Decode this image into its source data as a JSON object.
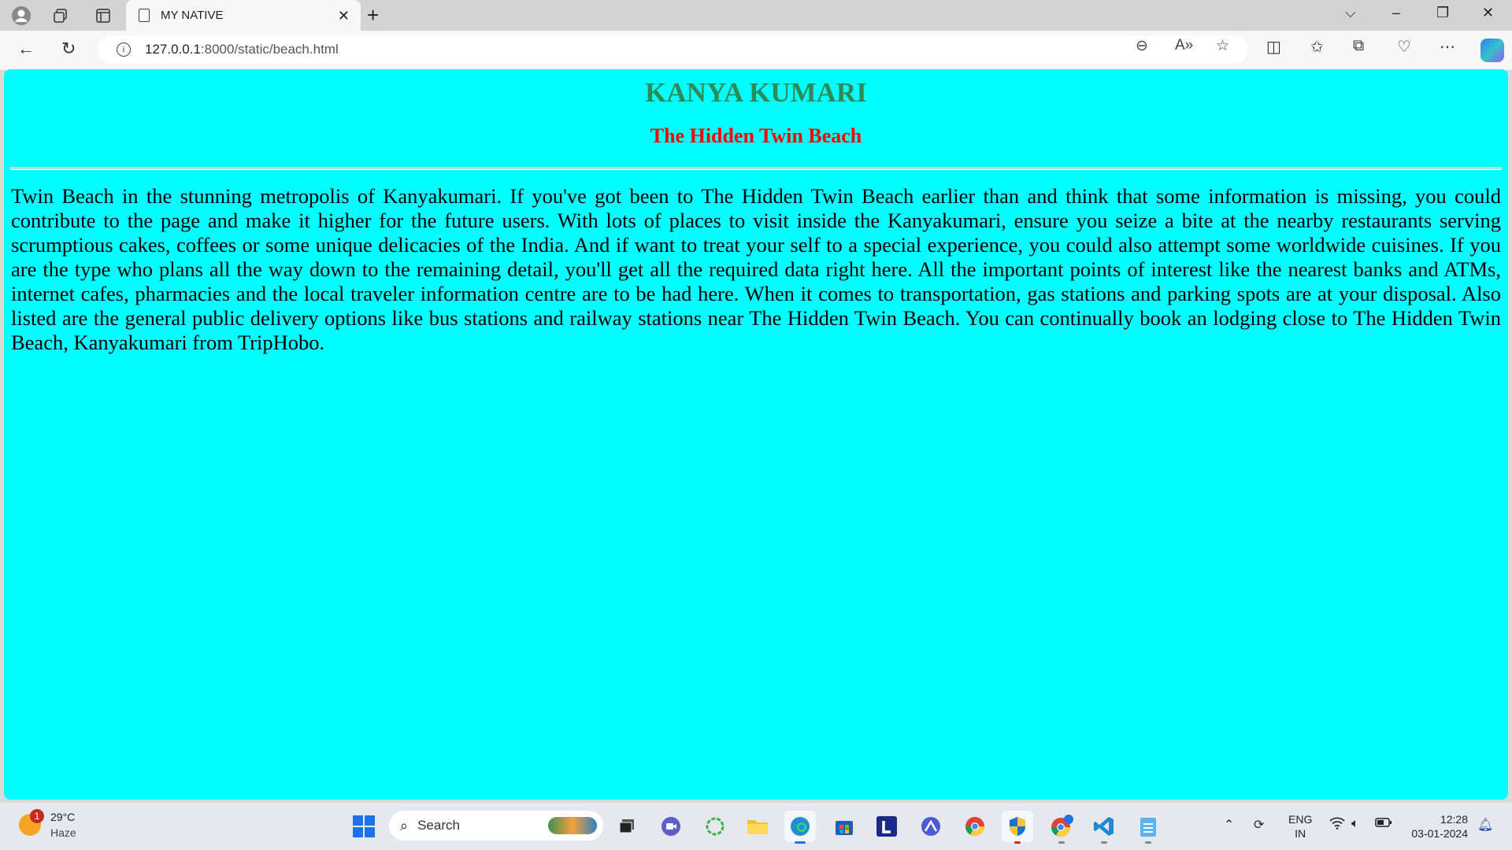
{
  "browser": {
    "tab_title": "MY NATIVE",
    "url_host": "127.0.0.1",
    "url_path": ":8000/static/beach.html"
  },
  "page": {
    "heading": "KANYA KUMARI",
    "subheading": "The Hidden Twin Beach",
    "paragraph": "Twin Beach in the stunning metropolis of Kanyakumari. If you've got been to The Hidden Twin Beach earlier than and think that some information is missing, you could contribute to the page and make it higher for the future users. With lots of places to visit inside the Kanyakumari, ensure you seize a bite at the nearby restaurants serving scrumptious cakes, coffees or some unique delicacies of the India. And if want to treat your self to a special experience, you could also attempt some worldwide cuisines. If you are the type who plans all the way down to the remaining detail, you'll get all the required data right here. All the important points of interest like the nearest banks and ATMs, internet cafes, pharmacies and the local traveler information centre are to be had here. When it comes to transportation, gas stations and parking spots are at your disposal. Also listed are the general public delivery options like bus stations and railway stations near The Hidden Twin Beach. You can continually book an lodging close to The Hidden Twin Beach, Kanyakumari from TripHobo.",
    "colors": {
      "background": "#00ffff",
      "heading": "#2e8b57",
      "subheading": "#ff0000"
    }
  },
  "taskbar": {
    "weather_badge": "1",
    "weather_temp": "29°C",
    "weather_desc": "Haze",
    "search_label": "Search",
    "language_top": "ENG",
    "language_bottom": "IN",
    "time": "12:28",
    "date": "03-01-2024",
    "apps": [
      "task-view",
      "teams-meet",
      "copilot-loop",
      "file-explorer",
      "edge",
      "store",
      "l-app",
      "tunnel-app",
      "chrome",
      "security",
      "chrome-profile",
      "vscode",
      "notepad"
    ]
  }
}
